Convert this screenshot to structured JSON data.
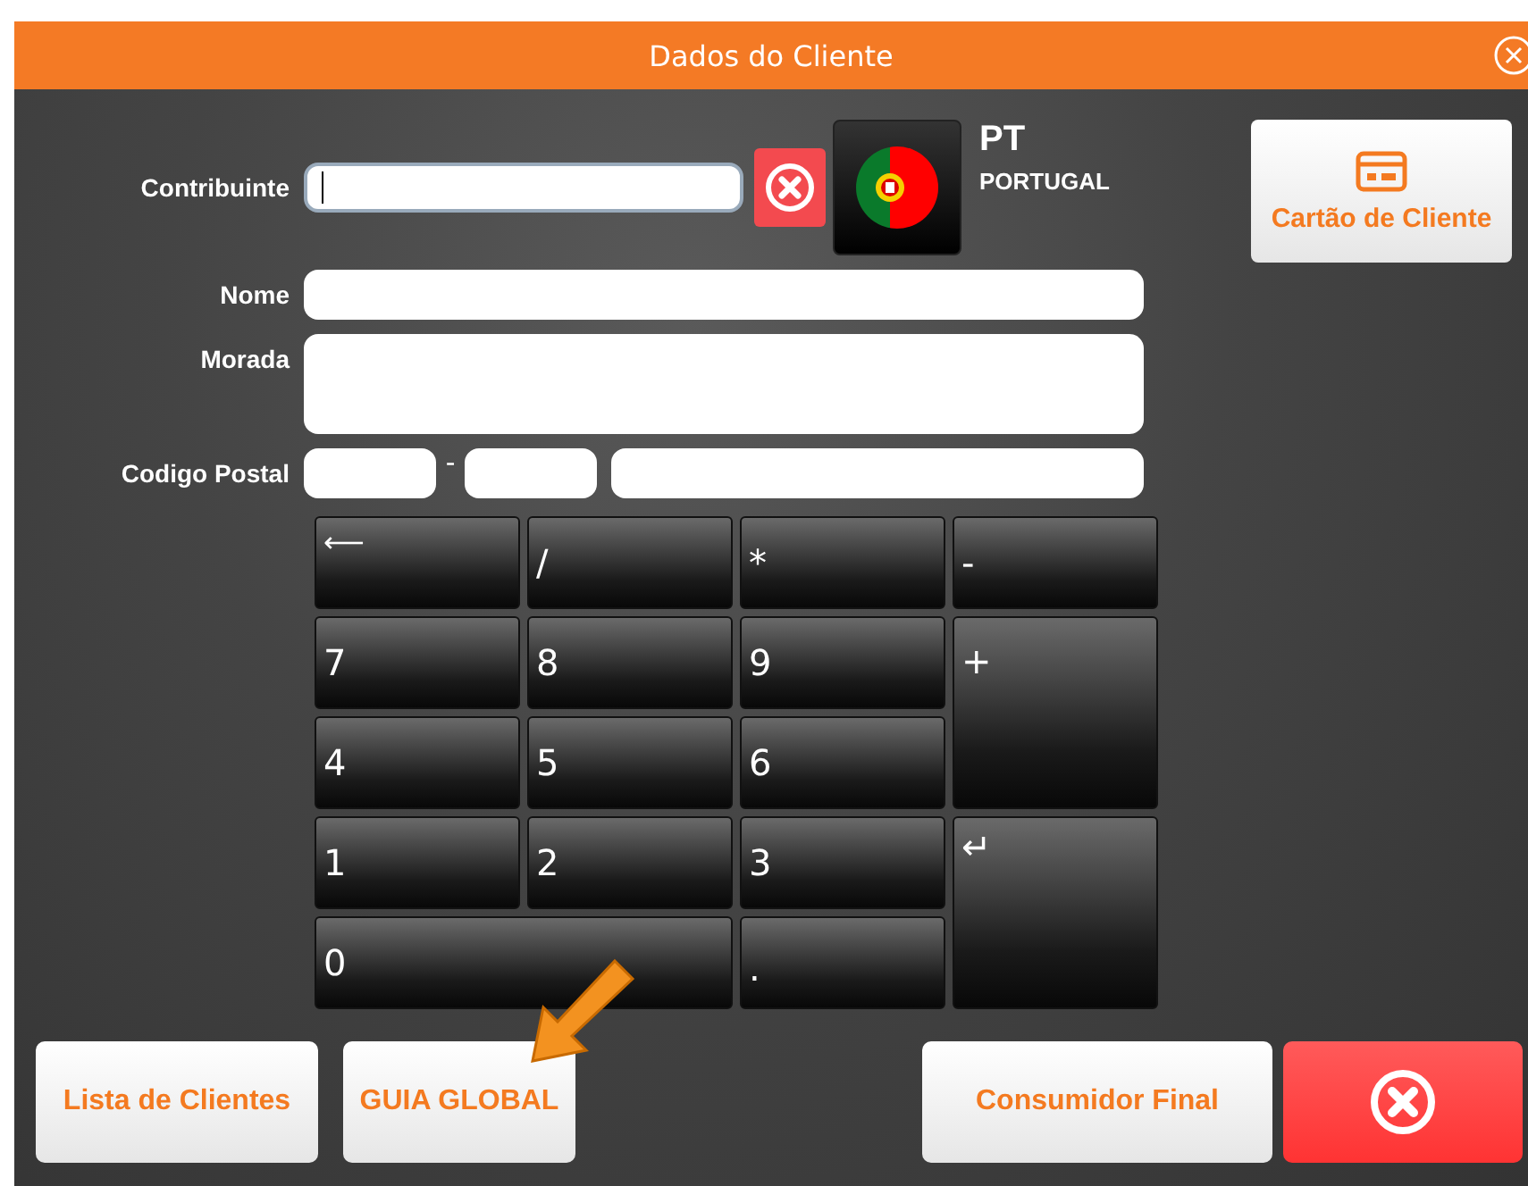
{
  "window": {
    "title": "Dados do Cliente"
  },
  "contribuinte": {
    "label": "Contribuinte",
    "focused": true
  },
  "country": {
    "code": "PT",
    "name": "PORTUGAL"
  },
  "card_button": {
    "label": "Cartão de Cliente"
  },
  "fields": [
    {
      "label": "Nome",
      "kind": "single"
    },
    {
      "label": "Morada",
      "kind": "multi"
    }
  ],
  "postal": {
    "label": "Codigo Postal",
    "separator": "-"
  },
  "keypad": [
    {
      "label": "⟵"
    },
    {
      "label": "/"
    },
    {
      "label": "*"
    },
    {
      "label": "-"
    },
    {
      "label": "7"
    },
    {
      "label": "8"
    },
    {
      "label": "9"
    },
    {
      "label": "+"
    },
    {
      "label": "4"
    },
    {
      "label": "5"
    },
    {
      "label": "6"
    },
    {
      "label": "1"
    },
    {
      "label": "2"
    },
    {
      "label": "3"
    },
    {
      "label": "↵"
    },
    {
      "label": "0"
    },
    {
      "label": "."
    }
  ],
  "buttons": [
    {
      "label": "Lista de Clientes",
      "kind": "text"
    },
    {
      "label": "GUIA GLOBAL",
      "kind": "text"
    },
    {
      "label": "Consumidor Final",
      "kind": "text"
    },
    {
      "kind": "cancel"
    }
  ]
}
